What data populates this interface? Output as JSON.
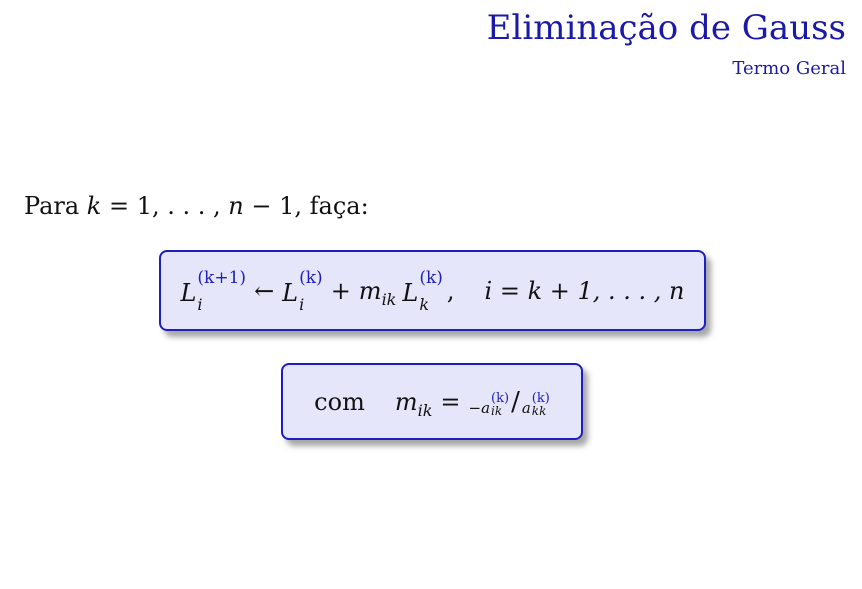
{
  "header": {
    "title": "Eliminação de Gauss",
    "subtitle": "Termo Geral"
  },
  "intro": {
    "prefix": "Para ",
    "k": "k",
    "equals": " = 1, . . . , ",
    "n": "n",
    "minus": " − 1, ",
    "suffix": "faça:"
  },
  "formula": {
    "L": "L",
    "i": "i",
    "k": "k",
    "sup_k1": "(k+1)",
    "sup_k": "(k)",
    "arrow": "←",
    "plus": "+",
    "m": "m",
    "ik": "ik",
    "comma": ",",
    "range_lhs": "i = k + 1, . . . , n"
  },
  "multiplier": {
    "com": "com",
    "m": "m",
    "ik": "ik",
    "equals": "=",
    "minus": "−",
    "a": "a",
    "kk": "kk",
    "sup_k": "(k)",
    "slash": "/"
  }
}
